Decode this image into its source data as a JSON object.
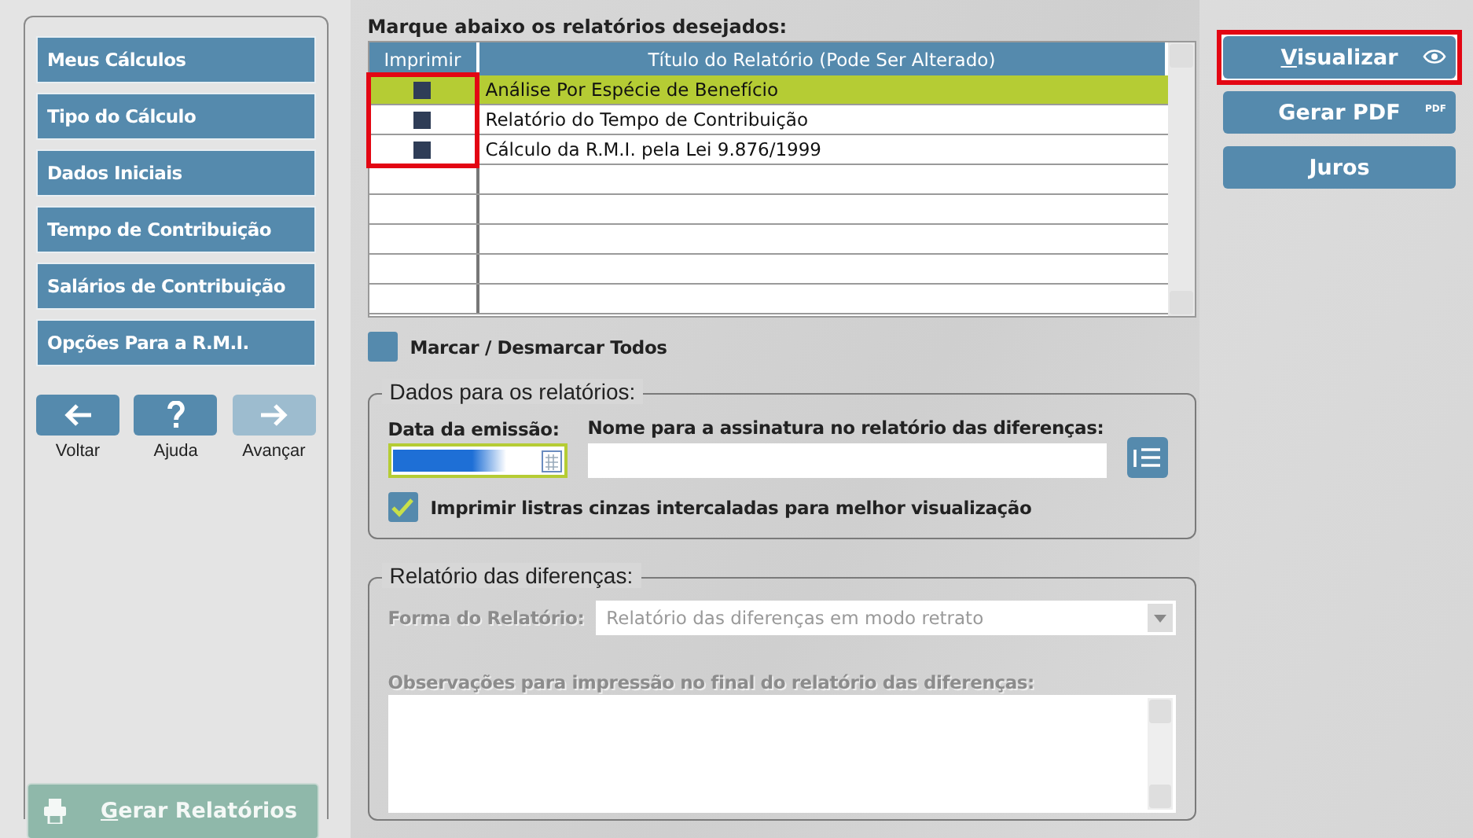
{
  "sidebar": {
    "items": [
      {
        "label": "Meus Cálculos"
      },
      {
        "label": "Tipo do Cálculo"
      },
      {
        "label": "Dados Iniciais"
      },
      {
        "label": "Tempo de Contribuição"
      },
      {
        "label": "Salários de Contribuição"
      },
      {
        "label": "Opções Para a R.M.I."
      }
    ],
    "nav": [
      {
        "kind": "back",
        "label": "Voltar",
        "disabled": false
      },
      {
        "kind": "help",
        "label": "Ajuda",
        "disabled": false
      },
      {
        "kind": "forward",
        "label": "Avançar",
        "disabled": true
      }
    ],
    "generate": {
      "label": "Gerar Relatórios",
      "disabled": true
    }
  },
  "reports": {
    "heading": "Marque abaixo os relatórios desejados:",
    "columns": [
      "Imprimir",
      "Título do Relatório (Pode Ser Alterado)"
    ],
    "print_column_highlighted": true,
    "rows": [
      {
        "title": "Análise Por Espécie de Benefício",
        "checked": true,
        "selected": true
      },
      {
        "title": "Relatório do Tempo de Contribuição",
        "checked": true,
        "selected": false
      },
      {
        "title": "Cálculo da R.M.I. pela Lei 9.876/1999",
        "checked": true,
        "selected": false
      }
    ],
    "toggle_all": {
      "label": "Marcar / Desmarcar Todos",
      "checked": false
    }
  },
  "report_data": {
    "legend": "Dados para os relatórios:",
    "date_label": "Data da emissão:",
    "signature_label": "Nome para a assinatura no relatório das diferenças:",
    "stripes": {
      "label": "Imprimir listras cinzas intercaladas para melhor visualização",
      "checked": true
    }
  },
  "differences": {
    "legend": "Relatório das diferenças:",
    "disabled": true,
    "form_label": "Forma do Relatório:",
    "form_value": "Relatório das diferenças em modo retrato",
    "notes_label": "Observações para impressão no final do relatório das diferenças:"
  },
  "actions": [
    {
      "kind": "view",
      "label": "Visualizar",
      "highlighted": true
    },
    {
      "kind": "pdf",
      "label": "Gerar PDF",
      "badge": "PDF",
      "highlighted": false
    },
    {
      "kind": "plain",
      "label": "Juros",
      "highlighted": false
    }
  ]
}
